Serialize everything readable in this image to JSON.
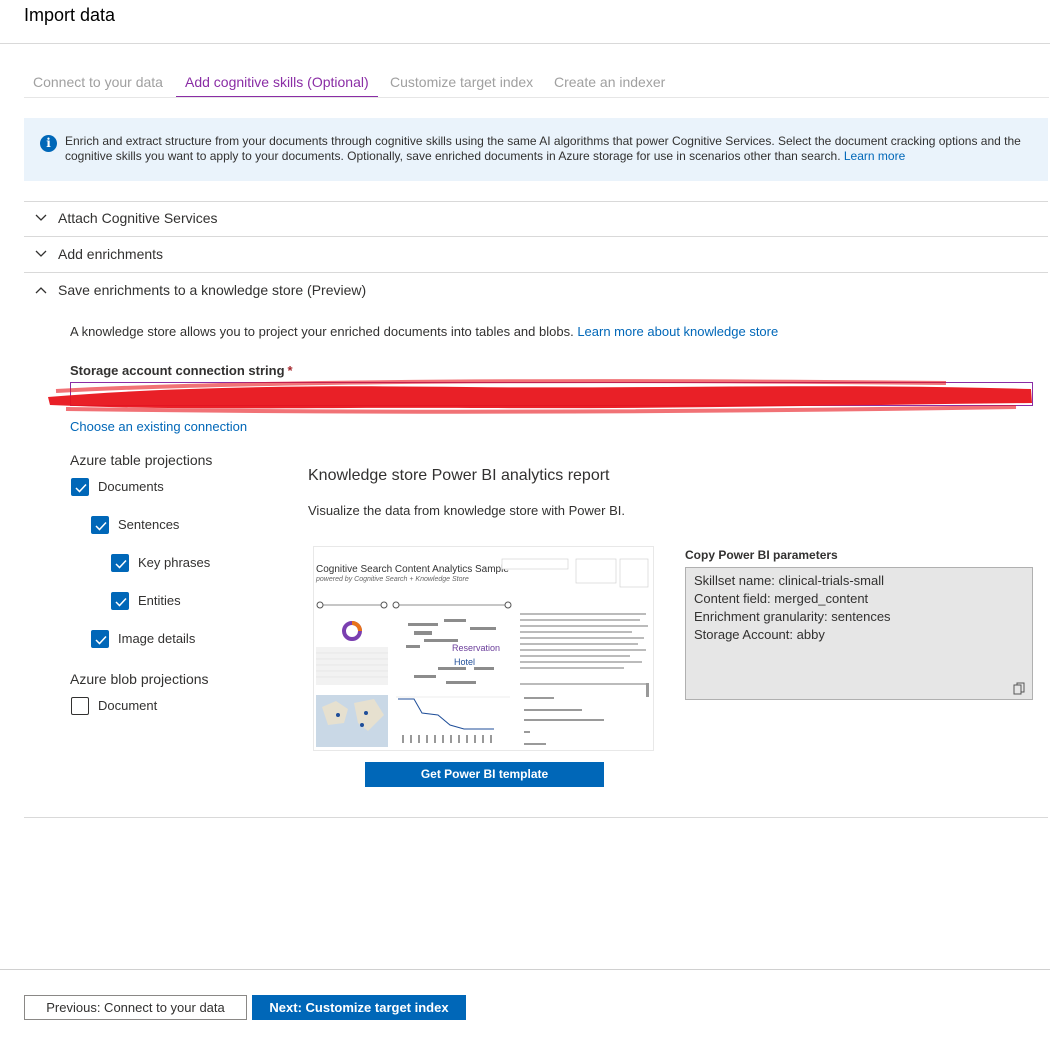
{
  "header": {
    "title": "Import data"
  },
  "tabs": [
    {
      "label": "Connect to your data",
      "active": false
    },
    {
      "label": "Add cognitive skills (Optional)",
      "active": true
    },
    {
      "label": "Customize target index",
      "active": false
    },
    {
      "label": "Create an indexer",
      "active": false
    }
  ],
  "info": {
    "text": "Enrich and extract structure from your documents through cognitive skills using the same AI algorithms that power Cognitive Services. Select the document cracking options and the cognitive skills you want to apply to your documents. Optionally, save enriched documents in Azure storage for use in scenarios other than search.",
    "link": "Learn more",
    "icon": "info-icon"
  },
  "sections": {
    "attach": {
      "label": "Attach Cognitive Services",
      "expanded": false
    },
    "enrich": {
      "label": "Add enrichments",
      "expanded": false
    },
    "store": {
      "label": "Save enrichments to a knowledge store (Preview)",
      "expanded": true
    }
  },
  "knowledge_store": {
    "description": "A knowledge store allows you to project your enriched documents into tables and blobs.",
    "learn_link": "Learn more about knowledge store",
    "connection_label": "Storage account connection string",
    "required_mark": "*",
    "connection_value": "",
    "choose_link": "Choose an existing connection",
    "table_projections_label": "Azure table projections",
    "table_projections": [
      {
        "label": "Documents",
        "checked": true
      },
      {
        "label": "Sentences",
        "checked": true
      },
      {
        "label": "Key phrases",
        "checked": true
      },
      {
        "label": "Entities",
        "checked": true
      },
      {
        "label": "Image details",
        "checked": true
      }
    ],
    "blob_projections_label": "Azure blob projections",
    "blob_projections": [
      {
        "label": "Document",
        "checked": false
      }
    ]
  },
  "powerbi": {
    "title": "Knowledge store Power BI analytics report",
    "description": "Visualize the data from knowledge store with Power BI.",
    "thumbnail": {
      "title": "Cognitive Search Content Analytics Sample",
      "subtitle": "powered by Cognitive Search + Knowledge Store",
      "metric": "66",
      "words": [
        "Reservation",
        "Hotel"
      ]
    },
    "button": "Get Power BI template",
    "copy_title": "Copy Power BI parameters",
    "params": [
      "Skillset name: clinical-trials-small",
      "Content field: merged_content",
      "Enrichment granularity: sentences",
      "Storage Account: abby"
    ]
  },
  "footer": {
    "prev_button": "Previous: Connect to your data",
    "next_button": "Next: Customize target index"
  },
  "colors": {
    "accent": "#8a2da5",
    "primary": "#0067b8",
    "info_bg": "#eaf3fb",
    "redaction": "#e8141b"
  }
}
